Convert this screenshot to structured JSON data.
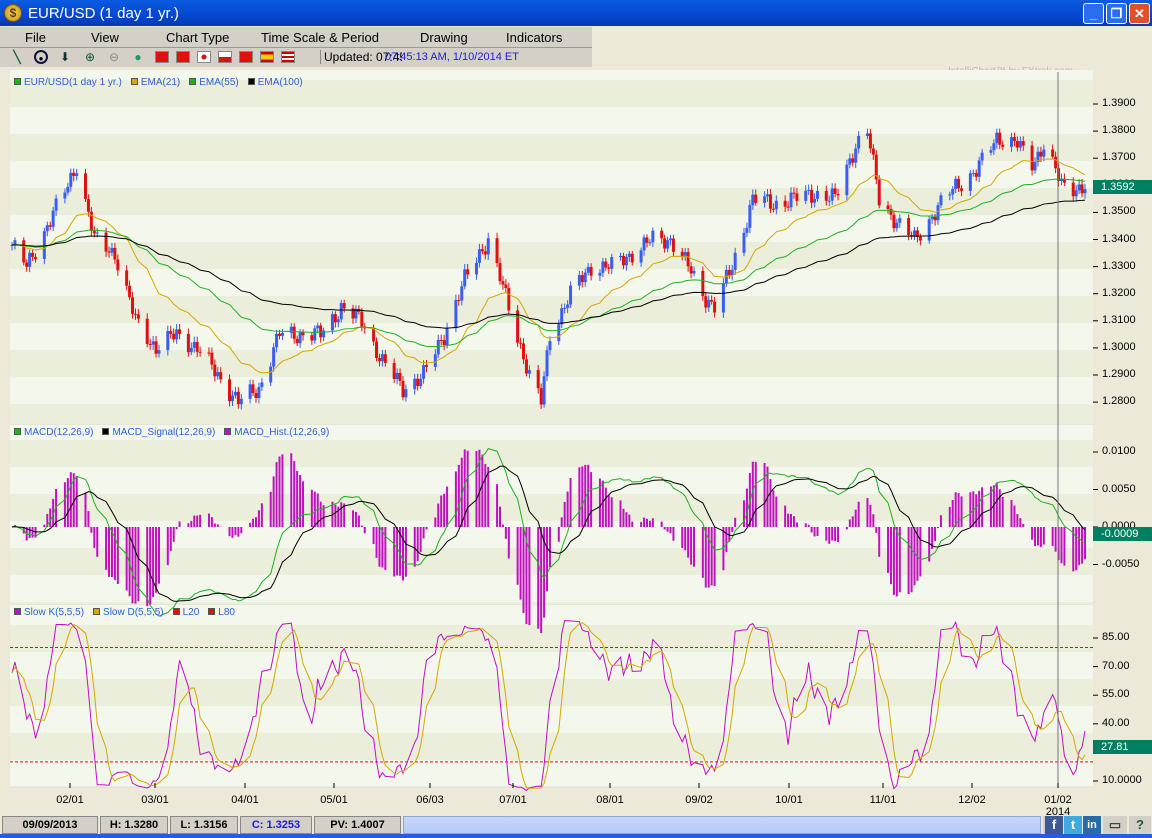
{
  "window": {
    "title": "EUR/USD (1 day  1 yr.)",
    "min": "_",
    "max": "❐",
    "close": "✕"
  },
  "menu": [
    "File",
    "View",
    "Chart Type",
    "Time Scale & Period",
    "Drawing",
    "Indicators"
  ],
  "toolbar": {
    "updated": "Updated: 07:45:05",
    "timestamp": "07:45:13 AM, 1/10/2014 ET",
    "icons": [
      "draw-line-icon",
      "target-icon",
      "arrow-down-icon",
      "zoom-in-icon",
      "zoom-out-icon",
      "globe-icon"
    ],
    "flags": [
      "china-flag",
      "hong-kong-flag",
      "japan-flag",
      "poland-flag",
      "turkey-flag",
      "spain-flag",
      "usa-flag"
    ]
  },
  "brand": "IntelliChart™ by FXtrek.com",
  "price_panel": {
    "legend": [
      {
        "label": "EUR/USD(1 day  1 yr.)",
        "color": "#20b020"
      },
      {
        "label": "EMA(21)",
        "color": "#d4a800"
      },
      {
        "label": "EMA(55)",
        "color": "#20b020"
      },
      {
        "label": "EMA(100)",
        "color": "#000000"
      }
    ],
    "ticks": [
      "1.3900",
      "1.3800",
      "1.3700",
      "1.3600",
      "1.3500",
      "1.3400",
      "1.3300",
      "1.3200",
      "1.3100",
      "1.3000",
      "1.2900",
      "1.2800"
    ],
    "current": "1.3592"
  },
  "macd_panel": {
    "legend": [
      {
        "label": "MACD(12,26,9)",
        "color": "#20b020"
      },
      {
        "label": "MACD_Signal(12,26,9)",
        "color": "#000000"
      },
      {
        "label": "MACD_Hist.(12,26,9)",
        "color": "#c010c0"
      }
    ],
    "ticks": [
      "0.0100",
      "0.0050",
      "0.0000",
      "-0.0050"
    ],
    "current": "-0.0009"
  },
  "stoch_panel": {
    "legend": [
      {
        "label": "Slow K(5,5,5)",
        "color": "#c010c0"
      },
      {
        "label": "Slow D(5,5,5)",
        "color": "#d4a800"
      },
      {
        "label": "L20",
        "color": "#e01010"
      },
      {
        "label": "L80",
        "color": "#e01010"
      }
    ],
    "ticks": [
      "85.00",
      "70.00",
      "55.00",
      "40.00",
      "25.00",
      "10.0000"
    ],
    "current": "27.81",
    "levels": [
      20,
      80
    ]
  },
  "dates": [
    "02/01",
    "03/01",
    "04/01",
    "05/01",
    "06/03",
    "07/01",
    "08/01",
    "09/02",
    "10/01",
    "11/01",
    "12/02",
    "01/02"
  ],
  "year_label": "2014",
  "status": {
    "date": "09/09/2013",
    "high": "H: 1.3280",
    "low": "L: 1.3156",
    "close": "C: 1.3253",
    "pv": "PV: 1.4007"
  },
  "colors": {
    "up": "#3a5ef0",
    "down": "#e01010",
    "accent": "#008060"
  },
  "chart_data": {
    "type": "candlestick",
    "range": [
      "2013-01-10",
      "2014-01-10"
    ],
    "ylim": [
      1.27,
      1.395
    ],
    "dates": [
      "2013-01-10",
      "2013-01-15",
      "2013-01-22",
      "2013-01-29",
      "2013-02-01",
      "2013-02-07",
      "2013-02-14",
      "2013-02-21",
      "2013-02-28",
      "2013-03-07",
      "2013-03-14",
      "2013-03-21",
      "2013-03-28",
      "2013-04-04",
      "2013-04-11",
      "2013-04-18",
      "2013-04-25",
      "2013-05-02",
      "2013-05-09",
      "2013-05-16",
      "2013-05-23",
      "2013-05-30",
      "2013-06-06",
      "2013-06-13",
      "2013-06-18",
      "2013-06-21",
      "2013-06-28",
      "2013-07-05",
      "2013-07-09",
      "2013-07-12",
      "2013-07-19",
      "2013-07-26",
      "2013-08-02",
      "2013-08-09",
      "2013-08-16",
      "2013-08-22",
      "2013-08-28",
      "2013-09-02",
      "2013-09-06",
      "2013-09-12",
      "2013-09-19",
      "2013-09-26",
      "2013-10-03",
      "2013-10-10",
      "2013-10-17",
      "2013-10-24",
      "2013-10-28",
      "2013-11-01",
      "2013-11-08",
      "2013-11-13",
      "2013-11-20",
      "2013-11-27",
      "2013-12-04",
      "2013-12-11",
      "2013-12-18",
      "2013-12-23",
      "2013-12-27",
      "2014-01-02",
      "2014-01-10"
    ],
    "close": [
      1.338,
      1.33,
      1.345,
      1.36,
      1.368,
      1.34,
      1.335,
      1.31,
      1.3,
      1.305,
      1.3,
      1.29,
      1.28,
      1.285,
      1.305,
      1.305,
      1.305,
      1.315,
      1.31,
      1.295,
      1.285,
      1.29,
      1.305,
      1.325,
      1.335,
      1.34,
      1.315,
      1.29,
      1.28,
      1.305,
      1.32,
      1.33,
      1.33,
      1.335,
      1.34,
      1.34,
      1.33,
      1.32,
      1.315,
      1.33,
      1.355,
      1.353,
      1.355,
      1.357,
      1.355,
      1.375,
      1.38,
      1.355,
      1.345,
      1.34,
      1.35,
      1.36,
      1.365,
      1.378,
      1.375,
      1.368,
      1.375,
      1.36,
      1.359
    ]
  }
}
